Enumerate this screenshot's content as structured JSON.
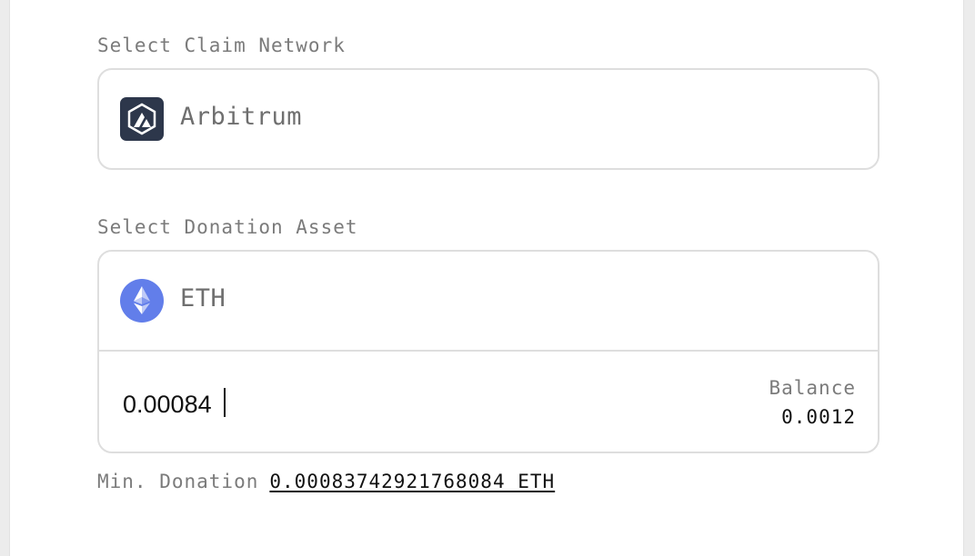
{
  "claim_network": {
    "label": "Select Claim Network",
    "selected": {
      "name": "Arbitrum",
      "icon": "arbitrum-icon",
      "icon_bg": "#2d374b"
    }
  },
  "donation_asset": {
    "label": "Select Donation Asset",
    "selected": {
      "name": "ETH",
      "icon": "ethereum-icon",
      "icon_bg": "#627eea"
    },
    "amount_value": "0.00084",
    "balance_label": "Balance",
    "balance_value": "0.0012"
  },
  "min_donation": {
    "label": "Min. Donation",
    "value": "0.00083742921768084 ETH"
  },
  "colors": {
    "border": "#dedede",
    "muted_text": "#7b7b7b",
    "text": "#111111"
  }
}
